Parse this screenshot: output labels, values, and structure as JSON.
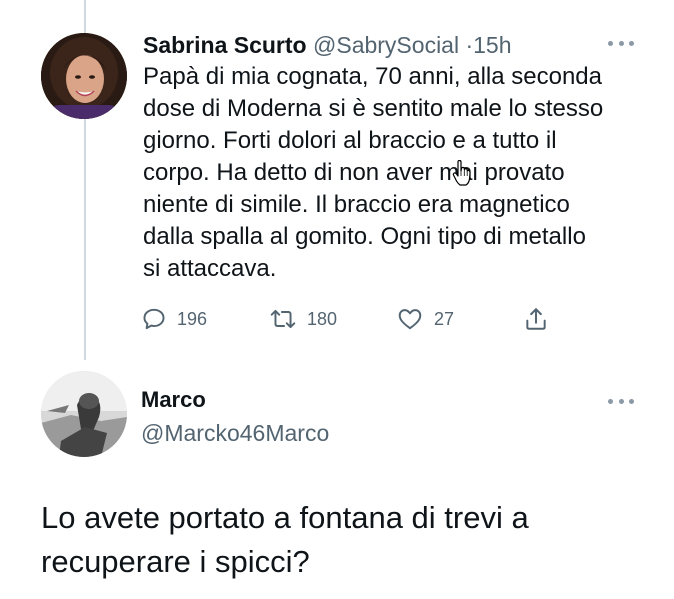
{
  "tweet": {
    "author_name": "Sabrina Scurto",
    "author_handle": "@SabrySocial",
    "separator": "·",
    "time": "15h",
    "text_lines": [
      "Papà di mia cognata, 70 anni, alla seconda",
      "dose di Moderna si è sentito male lo stesso",
      "giorno. Forti dolori al braccio e a tutto il",
      "corpo. Ha detto di non aver mai provato",
      "niente di simile. Il braccio era magnetico",
      "dalla spalla al gomito. Ogni tipo di metallo",
      "si attaccava."
    ],
    "actions": {
      "replies": "196",
      "retweets": "180",
      "likes": "27"
    }
  },
  "reply": {
    "author_name": "Marco",
    "author_handle": "@Marcko46Marco",
    "text_lines": [
      "Lo avete portato a fontana di trevi a",
      "recuperare i spicci?"
    ]
  },
  "colors": {
    "text": "#0f1419",
    "secondary": "#536471",
    "thread_line": "#cfd9de"
  },
  "icons": [
    "reply-icon",
    "retweet-icon",
    "like-icon",
    "share-icon",
    "more-icon",
    "hand-cursor-icon"
  ]
}
